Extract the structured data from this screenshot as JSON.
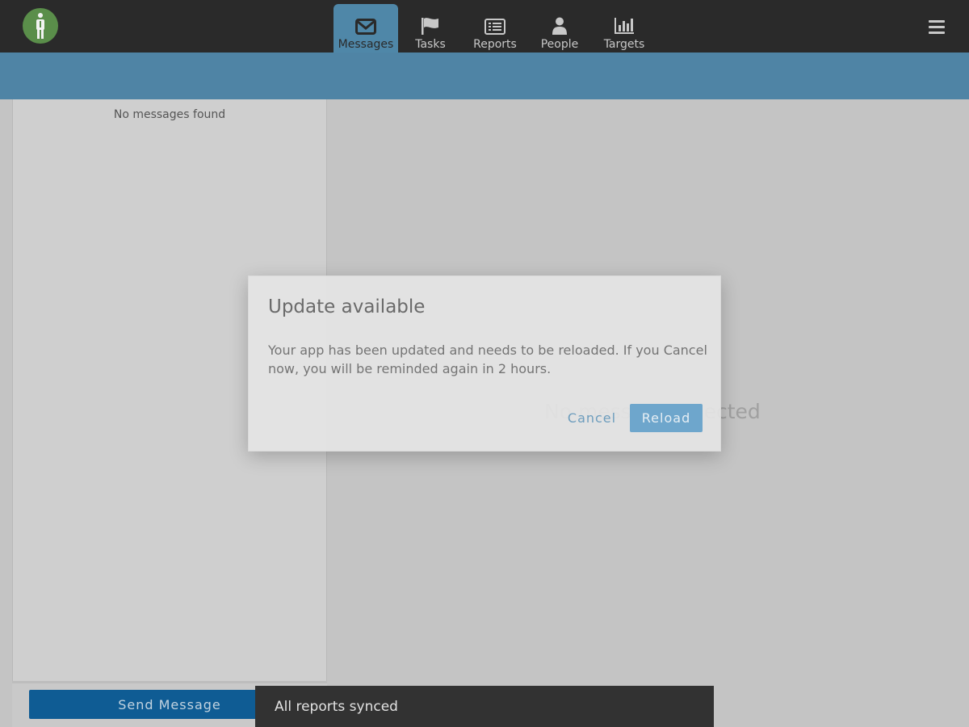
{
  "nav": {
    "tabs": [
      {
        "label": "Messages",
        "icon": "envelope-icon",
        "active": true
      },
      {
        "label": "Tasks",
        "icon": "flag-icon",
        "active": false
      },
      {
        "label": "Reports",
        "icon": "list-icon",
        "active": false
      },
      {
        "label": "People",
        "icon": "person-icon",
        "active": false
      },
      {
        "label": "Targets",
        "icon": "bar-chart-icon",
        "active": false
      }
    ],
    "menu_icon": "hamburger-menu-icon",
    "logo_icon": "person-logo-icon"
  },
  "messages": {
    "empty_list": "No messages found",
    "empty_detail": "No message selected",
    "send_button": "Send Message"
  },
  "modal": {
    "title": "Update available",
    "body": "Your app has been updated and needs to be reloaded. If you Cancel now, you will be reminded again in 2 hours.",
    "cancel": "Cancel",
    "reload": "Reload"
  },
  "toast": {
    "text": "All reports synced"
  },
  "colors": {
    "nav_bg": "#2a2a2a",
    "accent": "#4f84a5",
    "send_button": "#0f5c94",
    "reload_button": "#6ea6cc",
    "logo": "#5a8e4a"
  }
}
